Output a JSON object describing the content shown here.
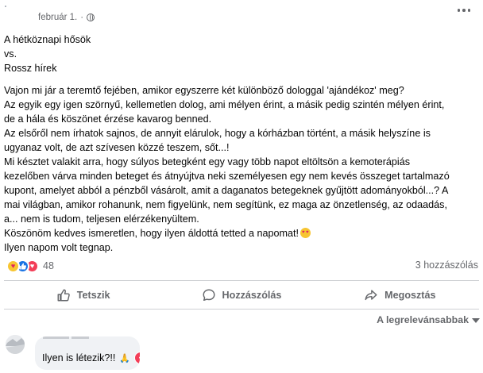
{
  "post": {
    "date": "február 1.",
    "lines": [
      "A hétköznapi hősök",
      "vs.",
      "Rossz hírek",
      "Vajon mi jár a teremtő fejében, amikor egyszerre két különböző dologgal 'ajándékoz' meg?",
      "Az egyik egy igen szörnyű, kellemetlen dolog, ami mélyen érint, a másik pedig szintén mélyen érint,",
      "de a hála és köszönet érzése kavarog benned.",
      "Az elsőről nem írhatok sajnos, de annyit elárulok, hogy a kórházban történt, a másik helyszíne is",
      "ugyanaz volt, de azt szívesen közzé teszem, sőt...!",
      "Mi késztet valakit arra, hogy súlyos betegként egy vagy több napot eltöltsön a kemoterápiás",
      "kezelőben várva minden beteget és átnyújtva neki személyesen egy nem kevés összeget tartalmazó",
      "kupont, amelyet abból a pénzből vásárolt, amit a daganatos betegeknek gyűjtött adományokból...? A",
      "mai világban, amikor rohanunk, nem figyelünk, nem segítünk, ez maga az önzetlenség, az odaadás,",
      "a... nem is tudom, teljesen elérzékenyültem.",
      "Köszönöm kedves ismeretlen, hogy ilyen áldottá tetted a napomat!",
      "Ilyen napom volt tegnap."
    ]
  },
  "icons": {
    "globe": "globe-icon",
    "more": "more-options-icon",
    "care": "care-reaction-icon",
    "like": "like-reaction-icon",
    "love": "love-reaction-icon",
    "heart_eyes": "heart-eyes-emoji",
    "pray": "folded-hands-emoji"
  },
  "reactions": {
    "count": "48"
  },
  "comments": {
    "count_label": "3 hozzászólás"
  },
  "actions": {
    "like": "Tetszik",
    "comment": "Hozzászólás",
    "share": "Megosztás"
  },
  "sort": {
    "label": "A legrelevánsabbak"
  },
  "comment": {
    "text": "Ilyen is létezik?!!"
  },
  "colors": {
    "text": "#050505",
    "secondary": "#65676b",
    "like_blue": "#1b74e4",
    "love_red": "#f33e58",
    "care_yellow": "#f7c531",
    "bubble_bg": "#f0f2f5",
    "divider": "#ced0d4"
  }
}
